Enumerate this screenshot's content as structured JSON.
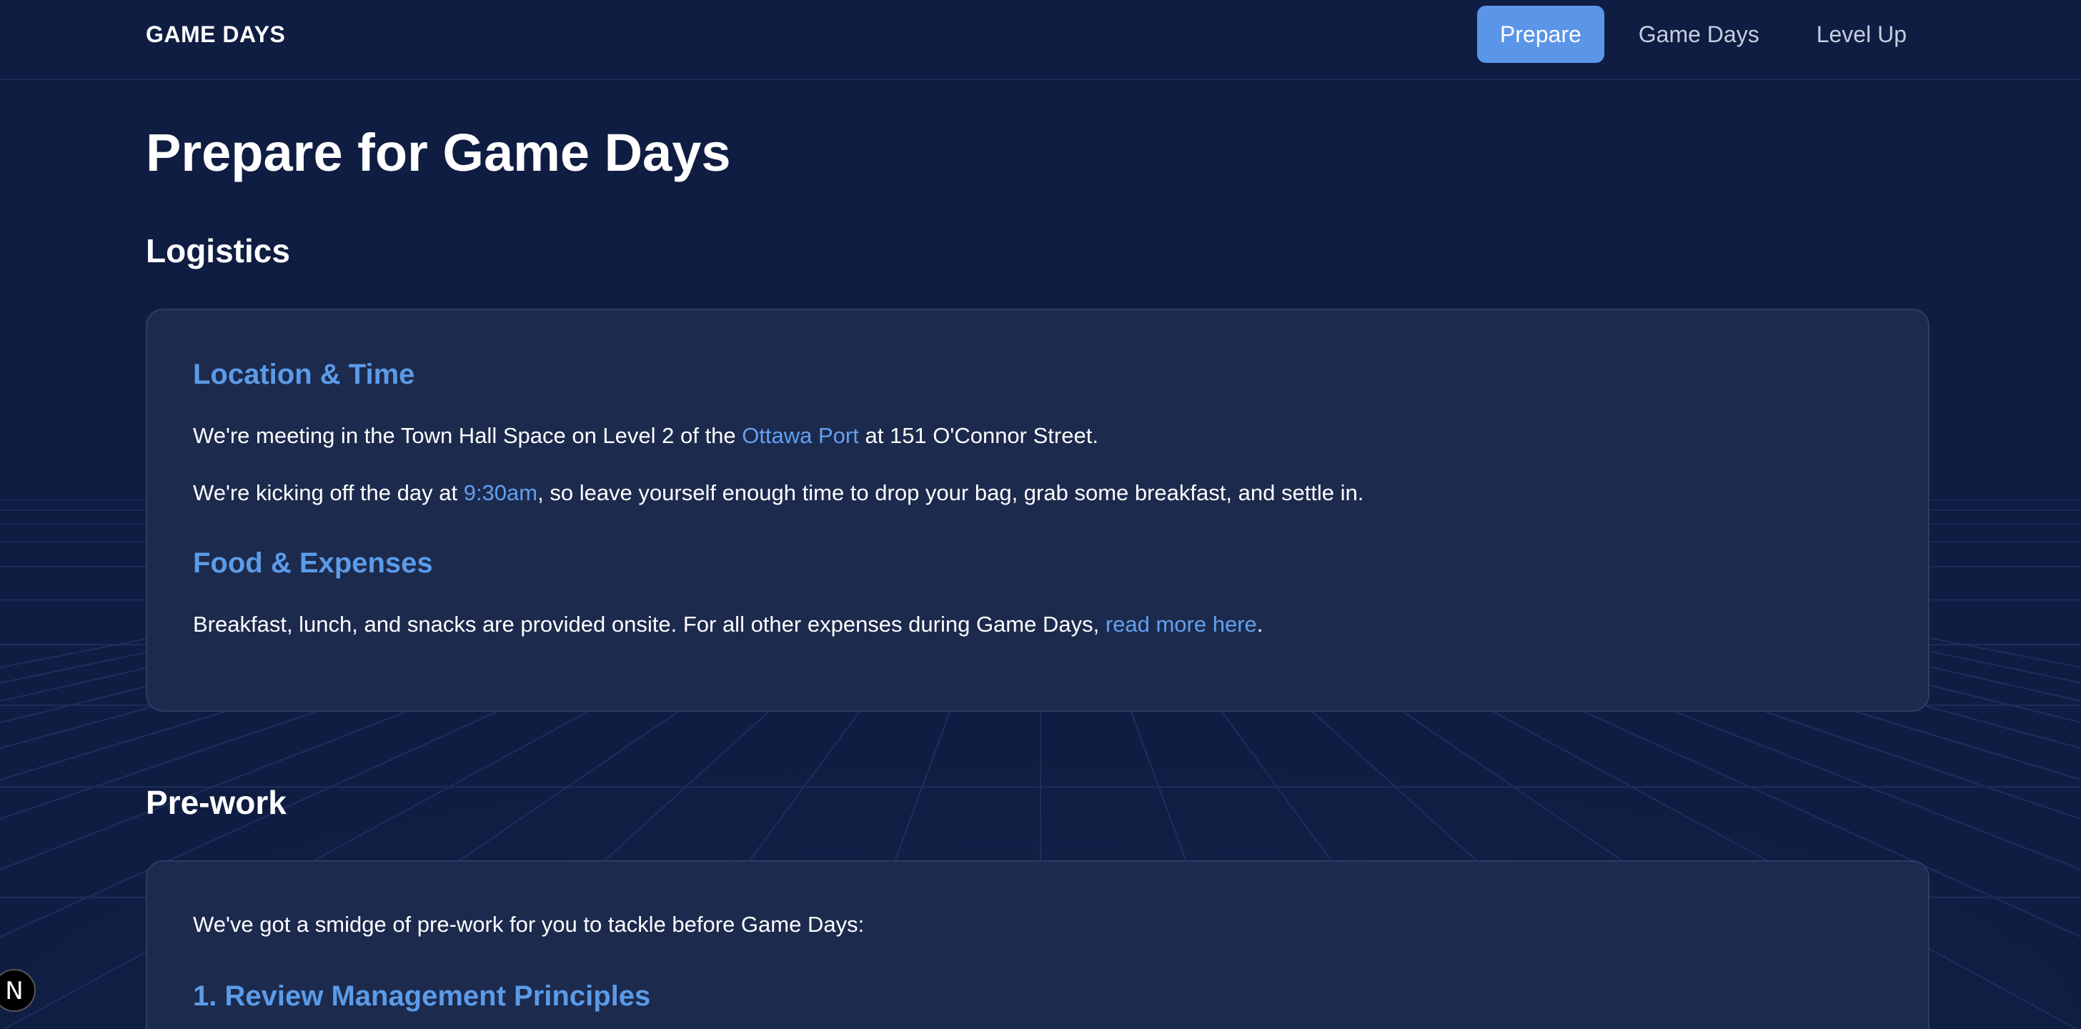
{
  "nav": {
    "brand": "GAME DAYS",
    "links": [
      {
        "label": "Prepare",
        "active": true
      },
      {
        "label": "Game Days",
        "active": false
      },
      {
        "label": "Level Up",
        "active": false
      }
    ]
  },
  "page": {
    "title": "Prepare for Game Days"
  },
  "logistics": {
    "title": "Logistics",
    "location": {
      "heading": "Location & Time",
      "p1_before": "We're meeting in the Town Hall Space on Level 2 of the ",
      "p1_link": "Ottawa Port",
      "p1_after": " at 151 O'Connor Street.",
      "p2_before": "We're kicking off the day at ",
      "p2_link": "9:30am",
      "p2_after": ", so leave yourself enough time to drop your bag, grab some breakfast, and settle in."
    },
    "food": {
      "heading": "Food & Expenses",
      "p_before": "Breakfast, lunch, and snacks are provided onsite. For all other expenses during Game Days, ",
      "p_link": "read more here",
      "p_after": "."
    }
  },
  "prework": {
    "title": "Pre-work",
    "intro": "We've got a smidge of pre-work for you to tackle before Game Days:",
    "item1_heading": "1. Review Management Principles"
  },
  "badge": {
    "label": "N"
  },
  "colors": {
    "background": "#0f1d42",
    "card": "#1c2a4d",
    "accent": "#5b95e8",
    "link": "#63a0ef"
  }
}
